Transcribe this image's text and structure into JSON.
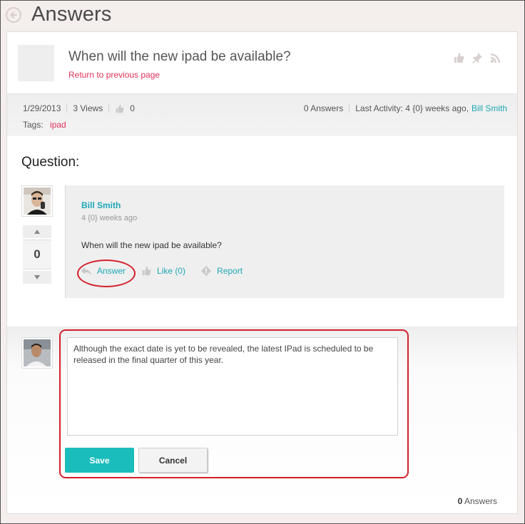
{
  "header": {
    "title": "Answers",
    "back_icon": "circle-arrow-left-icon"
  },
  "question": {
    "title": "When will the new ipad be available?",
    "return_link": "Return to previous page",
    "header_icons": [
      "thumbs-up-icon",
      "pin-icon",
      "rss-icon"
    ]
  },
  "meta": {
    "date": "1/29/2013",
    "views": "3 Views",
    "likes": "0",
    "answers": "0 Answers",
    "last_activity_label": "Last Activity: 4 {0} weeks ago,",
    "last_activity_user": "Bill Smith",
    "tags_label": "Tags:",
    "tag": "ipad"
  },
  "section_label": "Question:",
  "vote": {
    "count": "0"
  },
  "post": {
    "author": "Bill Smith",
    "time": "4 {0} weeks ago",
    "body": "When will the new ipad be available?",
    "answer_label": "Answer",
    "like_label": "Like (0)",
    "report_label": "Report"
  },
  "reply": {
    "text": "Although the exact date is yet to be revealed, the latest IPad is scheduled to be released in the final quarter of this year.",
    "save_label": "Save",
    "cancel_label": "Cancel"
  },
  "footer": {
    "answers_count": "0",
    "answers_label": "Answers"
  },
  "colors": {
    "accent_teal": "#1fa7b5",
    "save_button": "#1bbcbc",
    "link_red": "#e2335a",
    "highlight_red": "#d41f2a"
  }
}
